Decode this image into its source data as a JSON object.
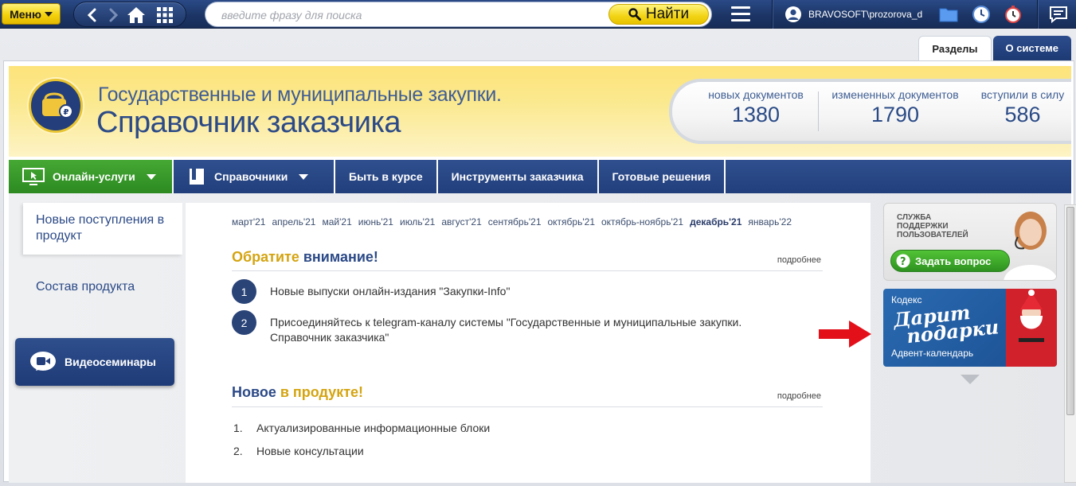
{
  "topbar": {
    "menu_label": "Меню",
    "search_placeholder": "введите фразу для поиска",
    "find_label": "Найти",
    "user_name": "BRAVOSOFT\\prozorova_d"
  },
  "tabs": [
    {
      "label": "Разделы"
    },
    {
      "label": "О системе"
    }
  ],
  "banner": {
    "subtitle": "Государственные и муниципальные закупки.",
    "title": "Справочник заказчика",
    "stats": [
      {
        "label": "новых документов",
        "value": "1380"
      },
      {
        "label": "измененных документов",
        "value": "1790"
      },
      {
        "label": "вступили в силу",
        "value": "586"
      }
    ]
  },
  "menubar": {
    "online": "Онлайн-услуги",
    "directories": "Справочники",
    "stay_informed": "Быть в курсе",
    "tools": "Инструменты заказчика",
    "solutions": "Готовые решения"
  },
  "left_nav": {
    "new_items": "Новые поступления в продукт",
    "composition": "Состав продукта",
    "video": "Видеосеминары"
  },
  "months": [
    "март'21",
    "апрель'21",
    "май'21",
    "июнь'21",
    "июль'21",
    "август'21",
    "сентябрь'21",
    "октябрь'21",
    "октябрь-ноябрь'21",
    "декабрь'21",
    "январь'22"
  ],
  "attention": {
    "title_a": "Обратите",
    "title_b": "внимание!",
    "more": "подробнее",
    "items": [
      {
        "num": "1",
        "text": "Новые выпуски онлайн-издания \"Закупки-Info\""
      },
      {
        "num": "2",
        "text": "Присоединяйтесь к telegram-каналу системы \"Государственные и муниципальные закупки. Справочник заказчика\""
      }
    ]
  },
  "new_in_product": {
    "title_a": "Новое",
    "title_b": "в продукте!",
    "more": "подробнее",
    "items": [
      {
        "num": "1.",
        "text": "Актуализированные информационные блоки"
      },
      {
        "num": "2.",
        "text": "Новые консультации"
      }
    ]
  },
  "support": {
    "line1": "СЛУЖБА",
    "line2": "ПОДДЕРЖКИ",
    "line3": "ПОЛЬЗОВАТЕЛЕЙ",
    "ask": "Задать вопрос"
  },
  "advent": {
    "brand": "Кодекс",
    "script1": "Дарит",
    "script2": "подарки",
    "sub": "Адвент-календарь"
  },
  "colors": {
    "brand_blue": "#2c4a87",
    "accent_gold": "#d4a410",
    "green": "#3a9a2a",
    "red_arrow": "#e3101a"
  }
}
